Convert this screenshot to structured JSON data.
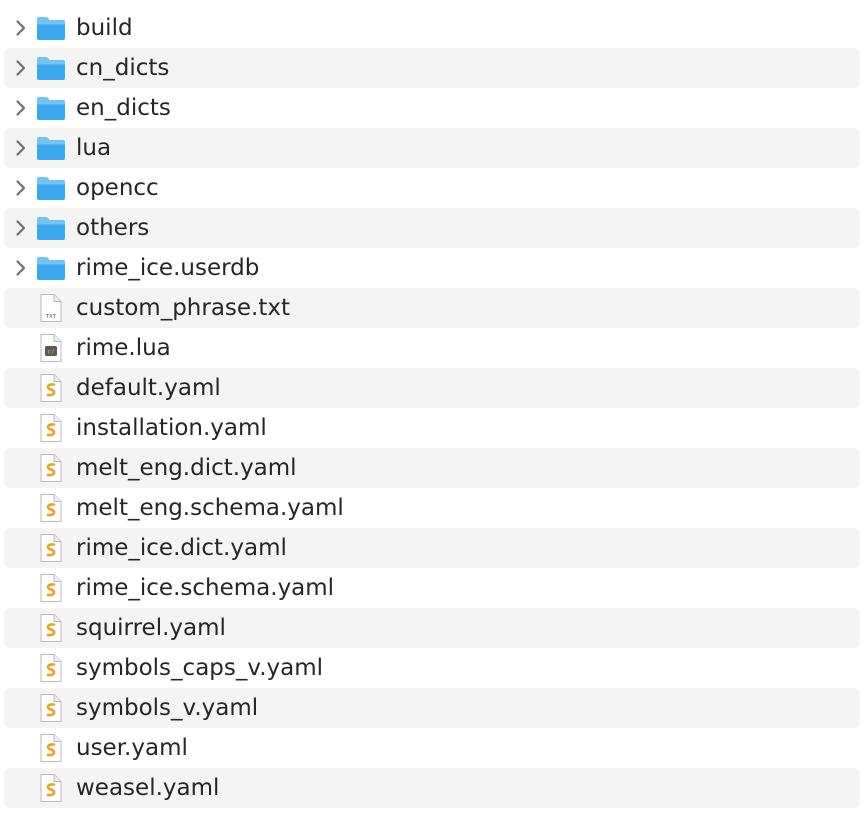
{
  "colors": {
    "row_alt_bg": "#f4f4f5",
    "folder_blue": "#3aa8ec",
    "folder_tab": "#6fc4f4",
    "text": "#262626",
    "yaml_accent": "#f0a020"
  },
  "items": [
    {
      "name": "build",
      "kind": "folder",
      "icon": "folder-icon",
      "expandable": true
    },
    {
      "name": "cn_dicts",
      "kind": "folder",
      "icon": "folder-icon",
      "expandable": true
    },
    {
      "name": "en_dicts",
      "kind": "folder",
      "icon": "folder-icon",
      "expandable": true
    },
    {
      "name": "lua",
      "kind": "folder",
      "icon": "folder-icon",
      "expandable": true
    },
    {
      "name": "opencc",
      "kind": "folder",
      "icon": "folder-icon",
      "expandable": true
    },
    {
      "name": "others",
      "kind": "folder",
      "icon": "folder-icon",
      "expandable": true
    },
    {
      "name": "rime_ice.userdb",
      "kind": "folder",
      "icon": "folder-icon",
      "expandable": true
    },
    {
      "name": "custom_phrase.txt",
      "kind": "txt",
      "icon": "txt-file-icon",
      "icon_label": "TXT",
      "expandable": false
    },
    {
      "name": "rime.lua",
      "kind": "lua",
      "icon": "lua-file-icon",
      "expandable": false
    },
    {
      "name": "default.yaml",
      "kind": "yaml",
      "icon": "yaml-file-icon",
      "expandable": false
    },
    {
      "name": "installation.yaml",
      "kind": "yaml",
      "icon": "yaml-file-icon",
      "expandable": false
    },
    {
      "name": "melt_eng.dict.yaml",
      "kind": "yaml",
      "icon": "yaml-file-icon",
      "expandable": false
    },
    {
      "name": "melt_eng.schema.yaml",
      "kind": "yaml",
      "icon": "yaml-file-icon",
      "expandable": false
    },
    {
      "name": "rime_ice.dict.yaml",
      "kind": "yaml",
      "icon": "yaml-file-icon",
      "expandable": false
    },
    {
      "name": "rime_ice.schema.yaml",
      "kind": "yaml",
      "icon": "yaml-file-icon",
      "expandable": false
    },
    {
      "name": "squirrel.yaml",
      "kind": "yaml",
      "icon": "yaml-file-icon",
      "expandable": false
    },
    {
      "name": "symbols_caps_v.yaml",
      "kind": "yaml",
      "icon": "yaml-file-icon",
      "expandable": false
    },
    {
      "name": "symbols_v.yaml",
      "kind": "yaml",
      "icon": "yaml-file-icon",
      "expandable": false
    },
    {
      "name": "user.yaml",
      "kind": "yaml",
      "icon": "yaml-file-icon",
      "expandable": false
    },
    {
      "name": "weasel.yaml",
      "kind": "yaml",
      "icon": "yaml-file-icon",
      "expandable": false
    }
  ]
}
